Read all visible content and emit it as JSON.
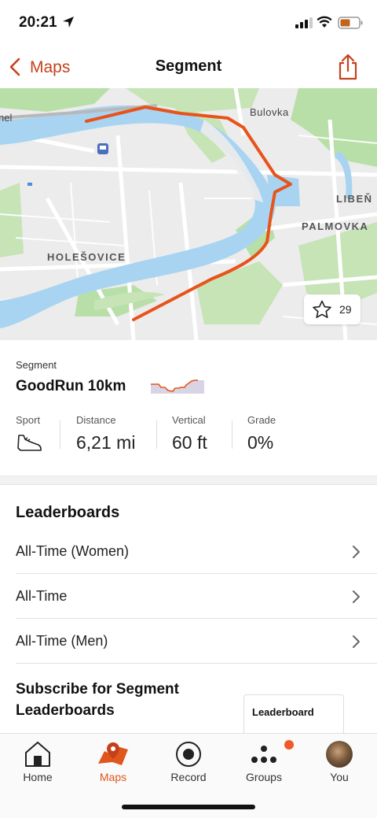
{
  "status_bar": {
    "time": "20:21"
  },
  "nav": {
    "back_label": "Maps",
    "title": "Segment"
  },
  "map": {
    "labels": {
      "bulovka": "Bulovka",
      "liben": "LIBEŇ",
      "palmovka": "PALMOVKA",
      "holesovice": "HOLEŠOVICE",
      "edge_text": "nel"
    },
    "star_count": "29"
  },
  "segment": {
    "small_label": "Segment",
    "name": "GoodRun 10km",
    "stats": {
      "sport_label": "Sport",
      "distance_label": "Distance",
      "distance_value": "6,21 mi",
      "vertical_label": "Vertical",
      "vertical_value": "60 ft",
      "grade_label": "Grade",
      "grade_value": "0%"
    }
  },
  "leaderboards": {
    "title": "Leaderboards",
    "rows": [
      "All-Time (Women)",
      "All-Time",
      "All-Time (Men)"
    ]
  },
  "subscribe": {
    "title": "Subscribe for Segment Leaderboards",
    "card_label": "Leaderboard"
  },
  "tabs": [
    {
      "label": "Home",
      "icon": "home-icon"
    },
    {
      "label": "Maps",
      "icon": "maps-icon"
    },
    {
      "label": "Record",
      "icon": "record-icon"
    },
    {
      "label": "Groups",
      "icon": "groups-icon"
    },
    {
      "label": "You",
      "icon": "avatar"
    }
  ],
  "colors": {
    "accent": "#e0561c",
    "route": "#e8531a",
    "river": "#a8d4f2",
    "park": "#b9dfa8"
  }
}
